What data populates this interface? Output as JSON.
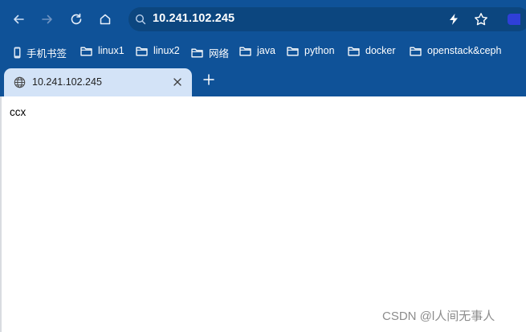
{
  "toolbar": {
    "url": "10.241.102.245"
  },
  "bookmarks": [
    {
      "label": "手机书签",
      "icon": "mobile-icon"
    },
    {
      "label": "linux1",
      "icon": "folder-icon"
    },
    {
      "label": "linux2",
      "icon": "folder-icon"
    },
    {
      "label": "网络",
      "icon": "folder-icon"
    },
    {
      "label": "java",
      "icon": "folder-icon"
    },
    {
      "label": "python",
      "icon": "folder-icon"
    },
    {
      "label": "docker",
      "icon": "folder-icon"
    },
    {
      "label": "openstack&ceph",
      "icon": "folder-icon"
    }
  ],
  "tab": {
    "title": "10.241.102.245"
  },
  "page": {
    "body_text": "ccx"
  },
  "watermark": "CSDN @l人间无事人",
  "colors": {
    "chrome": "#0f5298",
    "omnibox": "#0c467f",
    "active_tab": "#d3e3f7",
    "page_bg": "#ffffff"
  }
}
